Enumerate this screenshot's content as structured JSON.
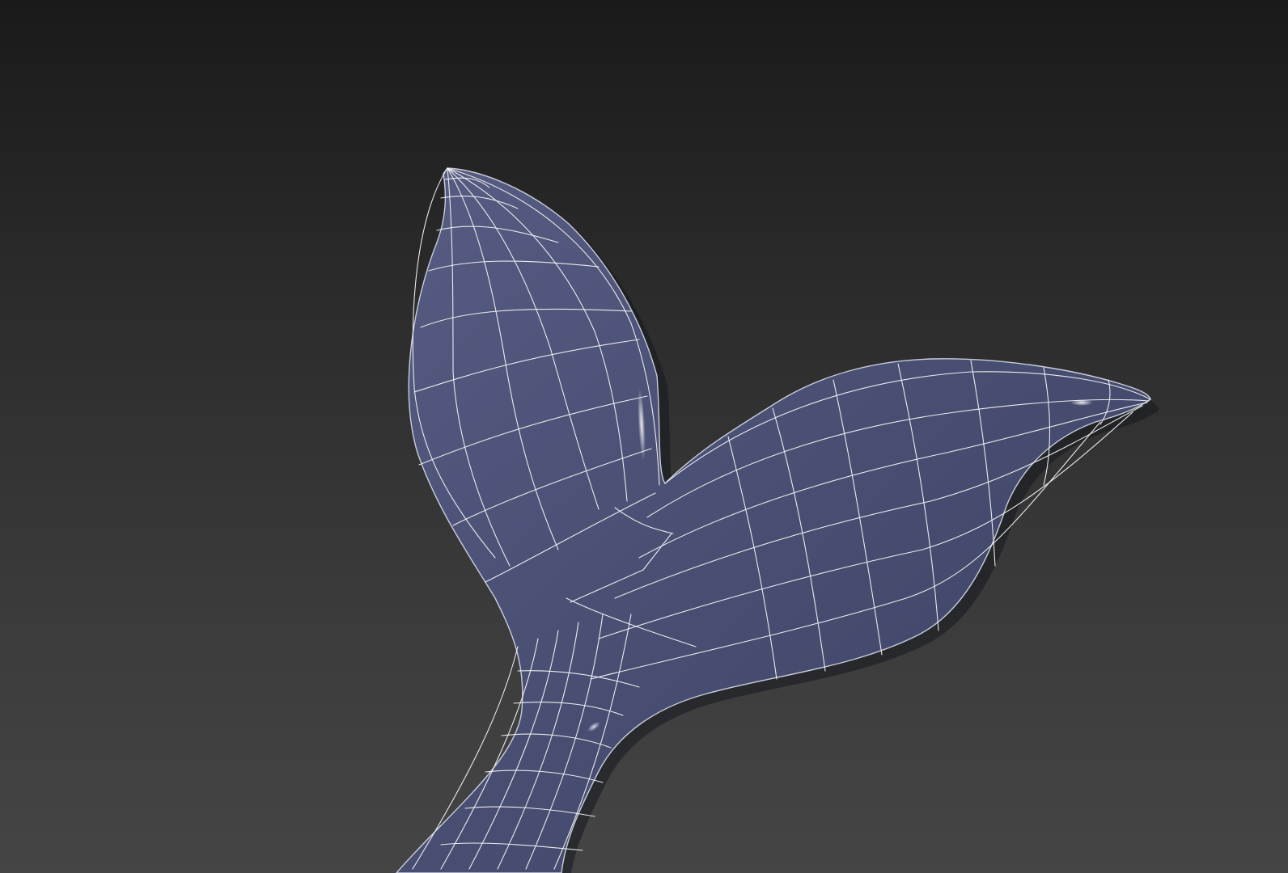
{
  "viewport": {
    "background_top_color": "#1a1a1a",
    "background_bottom_color": "#454545",
    "mesh_color": "#4a5072",
    "wire_color": "#f2f2f2"
  }
}
